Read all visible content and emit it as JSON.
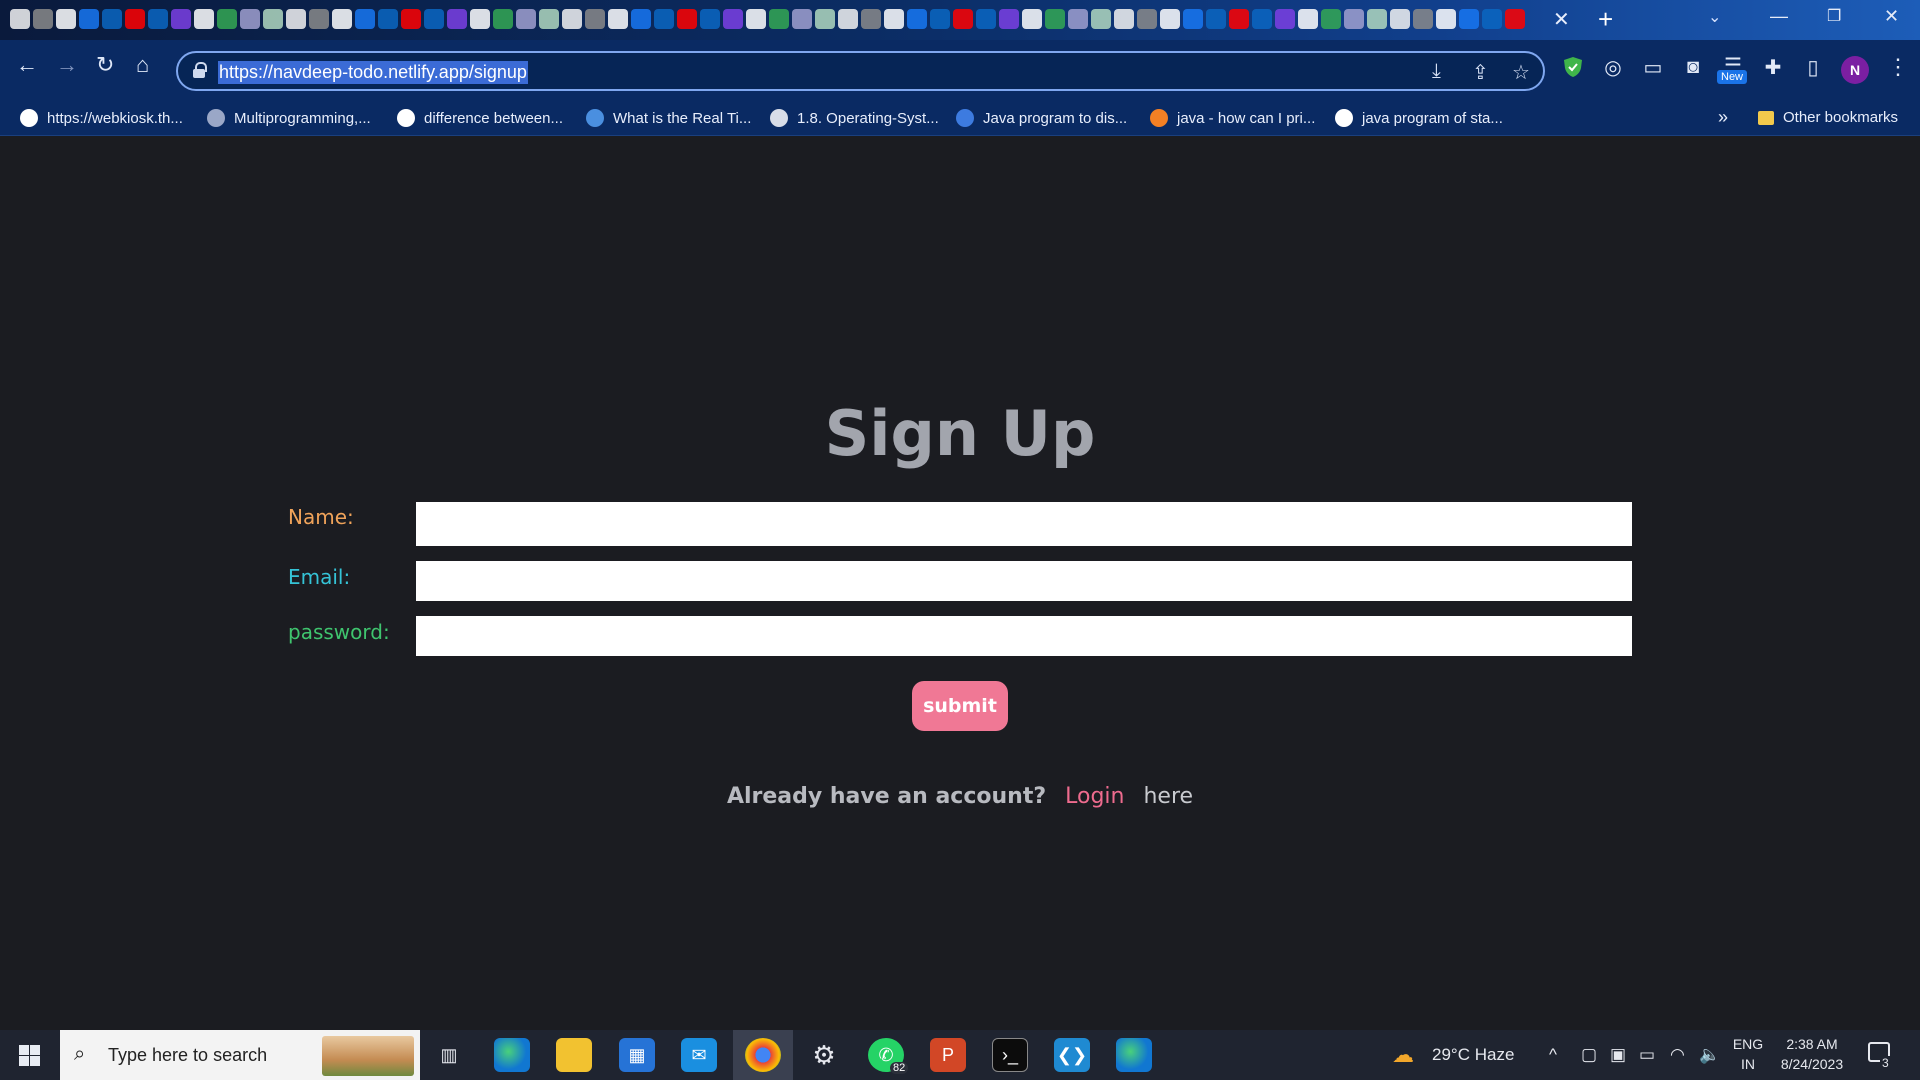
{
  "browser": {
    "url": "https://navdeep-todo.netlify.app/signup",
    "new_badge": "New",
    "profile_initial": "N",
    "bookmarks": [
      {
        "label": "https://webkiosk.th...",
        "icon_color": "#ffffff"
      },
      {
        "label": "Multiprogramming,...",
        "icon_color": "#9aa7c7"
      },
      {
        "label": "difference between...",
        "icon_color": "#ffffff"
      },
      {
        "label": "What is the Real Ti...",
        "icon_color": "#4a8fe0"
      },
      {
        "label": "1.8. Operating-Syst...",
        "icon_color": "#d8dde8"
      },
      {
        "label": "Java program to dis...",
        "icon_color": "#3d7be0"
      },
      {
        "label": "java - how can I pri...",
        "icon_color": "#f48024"
      },
      {
        "label": "java program of sta...",
        "icon_color": "#ffffff"
      }
    ],
    "bookmarks_more": "»",
    "other_bookmarks": "Other bookmarks"
  },
  "page": {
    "title": "Sign Up",
    "fields": [
      {
        "label": "Name:",
        "label_color": "#f0a35a",
        "value": ""
      },
      {
        "label": "Email:",
        "label_color": "#35c3d6",
        "value": ""
      },
      {
        "label": "password:",
        "label_color": "#3fc46e",
        "value": ""
      }
    ],
    "submit_label": "submit",
    "account_prompt": "Already have an account?",
    "login_link": "Login",
    "login_suffix": "here"
  },
  "taskbar": {
    "search_placeholder": "Type here to search",
    "whatsapp_badge": "82",
    "weather": "29°C  Haze",
    "language_line1": "ENG",
    "language_line2": "IN",
    "time": "2:38 AM",
    "date": "8/24/2023",
    "notification_count": "3"
  }
}
